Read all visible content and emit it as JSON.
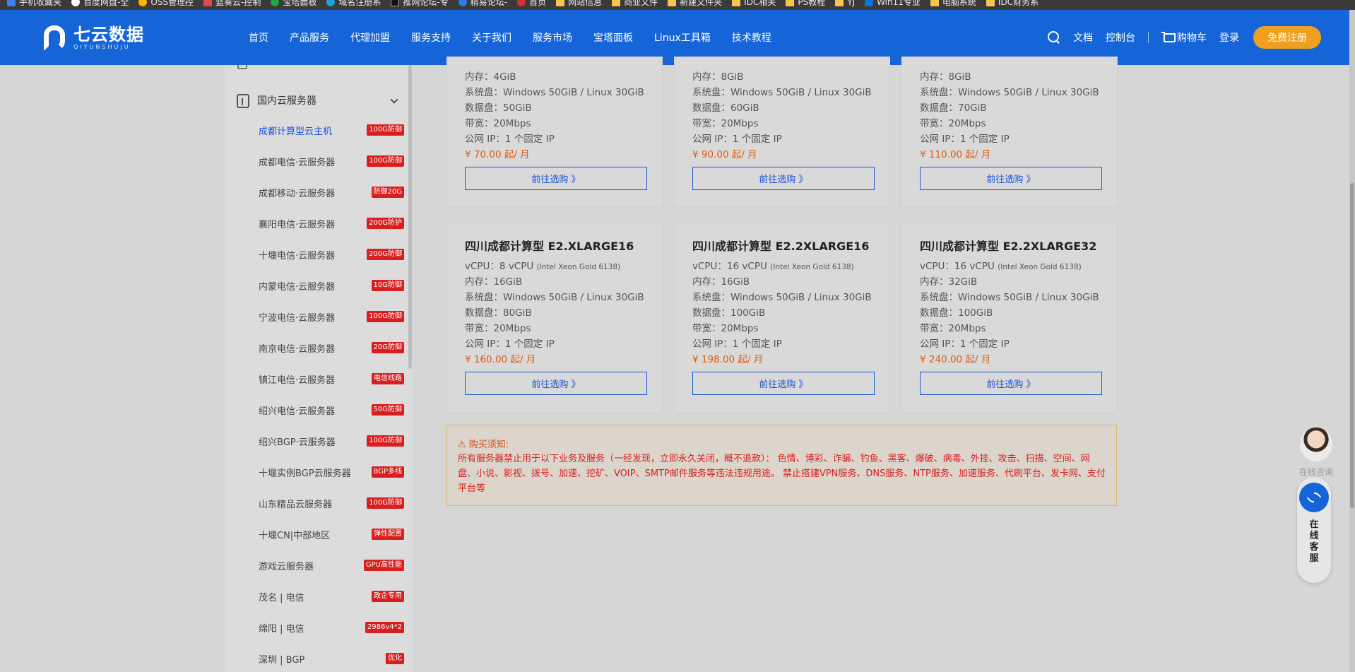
{
  "bookmarks": [
    {
      "label": "手机收藏夹",
      "icon": "c1"
    },
    {
      "label": "百度网盘-全",
      "icon": "c2"
    },
    {
      "label": "OSS管理控",
      "icon": "c3"
    },
    {
      "label": "蓝奏云-控制",
      "icon": "c4"
    },
    {
      "label": "宝塔面板",
      "icon": "c5"
    },
    {
      "label": "域名注册系",
      "icon": "c6"
    },
    {
      "label": "推网论坛-专",
      "icon": "c7"
    },
    {
      "label": "精易论坛-",
      "icon": "c8"
    },
    {
      "label": "首页",
      "icon": "c9"
    },
    {
      "label": "网站信息",
      "icon": "folder"
    },
    {
      "label": "商业文件",
      "icon": "folder"
    },
    {
      "label": "新建文件夹",
      "icon": "folder"
    },
    {
      "label": "IDC相关",
      "icon": "folder"
    },
    {
      "label": "PS教程",
      "icon": "folder"
    },
    {
      "label": "YJ",
      "icon": "folder"
    },
    {
      "label": "Win11专业",
      "icon": "c10"
    },
    {
      "label": "电脑系统",
      "icon": "folder"
    },
    {
      "label": "IDC财务系",
      "icon": "folder"
    }
  ],
  "header": {
    "logo_cn": "七云数据",
    "logo_en": "QIYUNSHUJU",
    "nav": [
      "首页",
      "产品服务",
      "代理加盟",
      "服务支持",
      "关于我们",
      "服务市场",
      "宝塔面板",
      "Linux工具箱",
      "技术教程"
    ],
    "docs": "文档",
    "console": "控制台",
    "cart": "购物车",
    "login": "登录",
    "register": "免费注册"
  },
  "sidebar": {
    "group_title": "国内云服务器",
    "items": [
      {
        "label": "成都计算型云主机",
        "badge": "100G防御"
      },
      {
        "label": "成都电信·云服务器",
        "badge": "100G防御"
      },
      {
        "label": "成都移动·云服务器",
        "badge": "防御20G"
      },
      {
        "label": "襄阳电信·云服务器",
        "badge": "200G防护"
      },
      {
        "label": "十堰电信·云服务器",
        "badge": "200G防御"
      },
      {
        "label": "内蒙电信·云服务器",
        "badge": "10G防御"
      },
      {
        "label": "宁波电信·云服务器",
        "badge": "100G防御"
      },
      {
        "label": "南京电信·云服务器",
        "badge": "20G防御"
      },
      {
        "label": "镇江电信·云服务器",
        "badge": "电信线路"
      },
      {
        "label": "绍兴电信·云服务器",
        "badge": "50G防御"
      },
      {
        "label": "绍兴BGP·云服务器",
        "badge": "100G防御"
      },
      {
        "label": "十堰实例BGP云服务器",
        "badge": "BGP多线"
      },
      {
        "label": "山东精品云服务器",
        "badge": "100G防御"
      },
      {
        "label": "十堰CN|中部地区",
        "badge": "弹性配置"
      },
      {
        "label": "游戏云服务器",
        "badge": "GPU高性能"
      },
      {
        "label": "茂名 | 电信",
        "badge": "政企专用"
      },
      {
        "label": "绵阳 | 电信",
        "badge": "2986v4*2"
      },
      {
        "label": "深圳 | BGP",
        "badge": "优化"
      }
    ]
  },
  "cards_top": [
    {
      "mem": "内存：4GiB",
      "sys": "系统盘：Windows 50GiB / Linux 30GiB",
      "data": "数据盘：50GiB",
      "bw": "带宽：20Mbps",
      "ip": "公网 IP：1 个固定 IP",
      "price": "¥ 70.00 起/ 月",
      "buy": "前往选购 》"
    },
    {
      "mem": "内存：8GiB",
      "sys": "系统盘：Windows 50GiB / Linux 30GiB",
      "data": "数据盘：60GiB",
      "bw": "带宽：20Mbps",
      "ip": "公网 IP：1 个固定 IP",
      "price": "¥ 90.00 起/ 月",
      "buy": "前往选购 》"
    },
    {
      "mem": "内存：8GiB",
      "sys": "系统盘：Windows 50GiB / Linux 30GiB",
      "data": "数据盘：70GiB",
      "bw": "带宽：20Mbps",
      "ip": "公网 IP：1 个固定 IP",
      "price": "¥ 110.00 起/ 月",
      "buy": "前往选购 》"
    }
  ],
  "cards_bottom": [
    {
      "title": "四川成都计算型 E2.XLARGE16",
      "vcpu": "vCPU：8 vCPU",
      "cpu_model": "(Intel Xeon Gold 6138)",
      "mem": "内存：16GiB",
      "sys": "系统盘：Windows 50GiB / Linux 30GiB",
      "data": "数据盘：80GiB",
      "bw": "带宽：20Mbps",
      "ip": "公网 IP：1 个固定 IP",
      "price": "¥ 160.00 起/ 月",
      "buy": "前往选购 》"
    },
    {
      "title": "四川成都计算型 E2.2XLARGE16",
      "vcpu": "vCPU：16 vCPU",
      "cpu_model": "(Intel Xeon Gold 6138)",
      "mem": "内存：16GiB",
      "sys": "系统盘：Windows 50GiB / Linux 30GiB",
      "data": "数据盘：100GiB",
      "bw": "带宽：20Mbps",
      "ip": "公网 IP：1 个固定 IP",
      "price": "¥ 198.00 起/ 月",
      "buy": "前往选购 》"
    },
    {
      "title": "四川成都计算型 E2.2XLARGE32",
      "vcpu": "vCPU：16 vCPU",
      "cpu_model": "(Intel Xeon Gold 6138)",
      "mem": "内存：32GiB",
      "sys": "系统盘：Windows 50GiB / Linux 30GiB",
      "data": "数据盘：100GiB",
      "bw": "带宽：20Mbps",
      "ip": "公网 IP：1 个固定 IP",
      "price": "¥ 240.00 起/ 月",
      "buy": "前往选购 》"
    }
  ],
  "notice": {
    "title": "⚠ 购买须知:",
    "body": "所有服务器禁止用于以下业务及服务（一经发现，立即永久关闭，概不退款）：  色情、博彩、诈骗、钓鱼、黑客、爆破、病毒、外挂、攻击、扫描、空间、网盘、小说、影视、拨号、加速、挖矿、VOIP、SMTP邮件服务等违法违规用途。 禁止搭建VPN服务、DNS服务、NTP服务、加速服务、代刷平台、发卡网、支付平台等"
  },
  "float": {
    "consult_label": "在线咨询",
    "kefu": [
      "在",
      "线",
      "客",
      "服"
    ]
  },
  "colors": {
    "brand_blue": "#1565d8",
    "price_orange": "#e05a10",
    "badge_red": "#d81e1e",
    "register_orange": "#f0a020"
  }
}
